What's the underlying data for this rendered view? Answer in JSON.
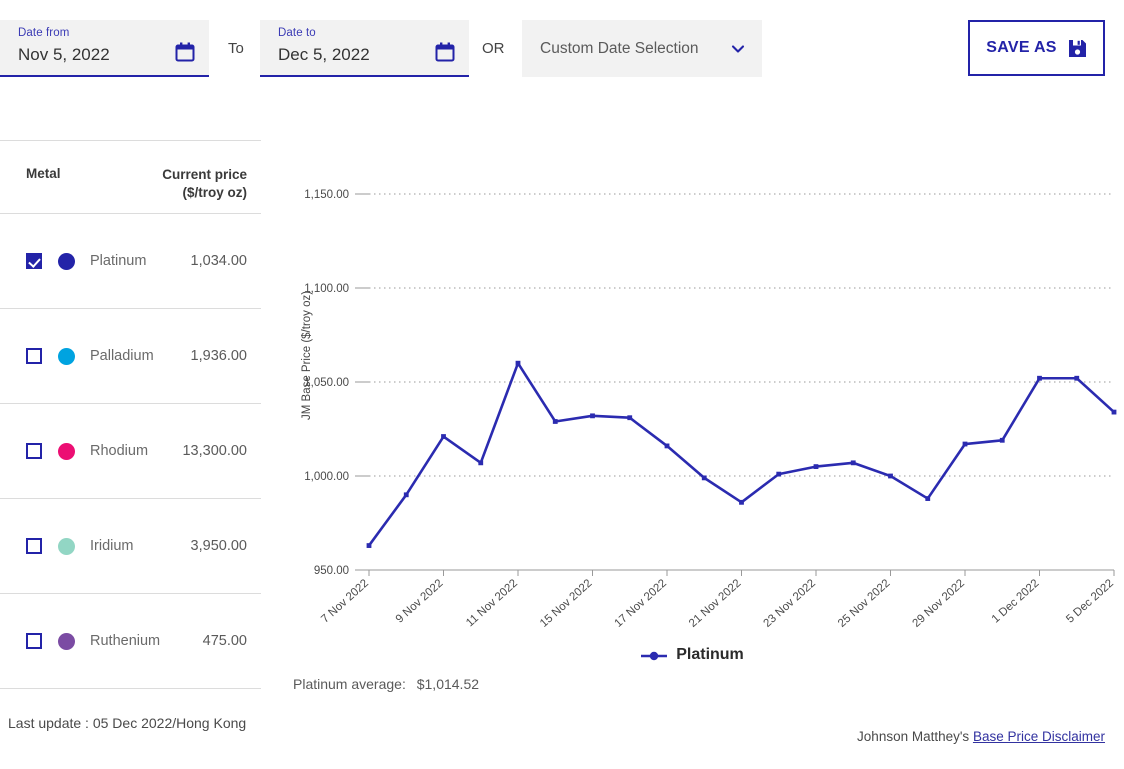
{
  "header": {
    "date_from": {
      "label": "Date from",
      "value": "Nov 5, 2022",
      "icon": "calendar-icon"
    },
    "conjunction_to": "To",
    "date_to": {
      "label": "Date to",
      "value": "Dec 5, 2022",
      "icon": "calendar-icon"
    },
    "conjunction_or": "OR",
    "custom_select": {
      "value": "Custom Date Selection",
      "icon": "chevron-down-icon"
    },
    "save_as": {
      "label": "SAVE AS",
      "icon": "save-disk-icon",
      "border_color": "#2323a8"
    }
  },
  "sidebar": {
    "columns": {
      "metal": "Metal",
      "price_line1": "Current price",
      "price_line2": "($/troy oz)"
    },
    "rows": [
      {
        "name": "Platinum",
        "price": "1,034.00",
        "color": "#2323a8",
        "checked": true
      },
      {
        "name": "Palladium",
        "price": "1,936.00",
        "color": "#00a3e0",
        "checked": false
      },
      {
        "name": "Rhodium",
        "price": "13,300.00",
        "color": "#ec0e73",
        "checked": false
      },
      {
        "name": "Iridium",
        "price": "3,950.00",
        "color": "#92d6c4",
        "checked": false
      },
      {
        "name": "Ruthenium",
        "price": "475.00",
        "color": "#7b4ba3",
        "checked": false
      }
    ],
    "last_update": "Last update : 05 Dec 2022/Hong Kong"
  },
  "footer": {
    "disclaimer_prefix": "Johnson Matthey's",
    "disclaimer_link": "Base Price Disclaimer"
  },
  "chart_meta": {
    "average_label": "Platinum average:",
    "average_value": "$1,014.52"
  },
  "chart_data": {
    "type": "line",
    "title": "",
    "xlabel": "",
    "ylabel": "JM Base Price ($/troy oz)",
    "ylim": [
      950,
      1150
    ],
    "yticks": [
      950,
      1000,
      1050,
      1100,
      1150
    ],
    "ytick_labels": [
      "950.00",
      "1,000.00",
      "1,050.00",
      "1,100.00",
      "1,150.00"
    ],
    "grid": true,
    "legend_position": "bottom-center",
    "x_tick_labels": [
      "7 Nov 2022",
      "9 Nov 2022",
      "11 Nov 2022",
      "15 Nov 2022",
      "17 Nov 2022",
      "21 Nov 2022",
      "23 Nov 2022",
      "25 Nov 2022",
      "29 Nov 2022",
      "1 Dec 2022",
      "5 Dec 2022"
    ],
    "x": [
      "7 Nov 2022",
      "8 Nov 2022",
      "9 Nov 2022",
      "10 Nov 2022",
      "11 Nov 2022",
      "14 Nov 2022",
      "15 Nov 2022",
      "16 Nov 2022",
      "17 Nov 2022",
      "18 Nov 2022",
      "21 Nov 2022",
      "22 Nov 2022",
      "23 Nov 2022",
      "24 Nov 2022",
      "25 Nov 2022",
      "28 Nov 2022",
      "29 Nov 2022",
      "30 Nov 2022",
      "1 Dec 2022",
      "2 Dec 2022",
      "5 Dec 2022"
    ],
    "series": [
      {
        "name": "Platinum",
        "color": "#2b2bb0",
        "values": [
          963,
          990,
          1021,
          1007,
          1060,
          1029,
          1032,
          1031,
          1016,
          999,
          986,
          1001,
          1005,
          1007,
          1000,
          988,
          1017,
          1019,
          1052,
          1052,
          1034
        ]
      }
    ]
  }
}
